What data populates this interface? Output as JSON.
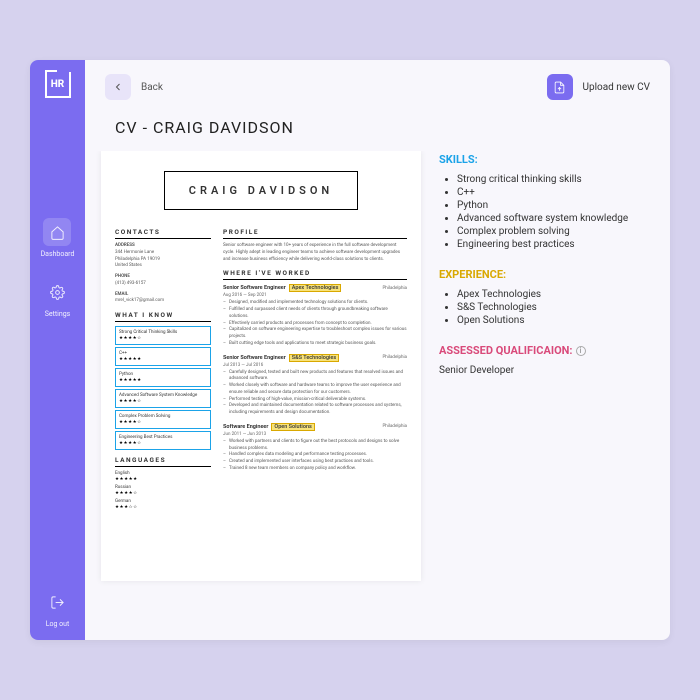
{
  "sidebar": {
    "logo": "HR",
    "items": [
      {
        "label": "Dashboard"
      },
      {
        "label": "Settings"
      }
    ],
    "logout": "Log out"
  },
  "topbar": {
    "back": "Back",
    "upload": "Upload new CV"
  },
  "title": "CV - CRAIG DAVIDSON",
  "resume": {
    "name": "CRAIG DAVIDSON",
    "contacts_h": "CONTACTS",
    "addr_h": "ADDRESS",
    "addr": "344 Hermonie Lane\nPhiladelphia PA 19019\nUnited States",
    "phone_h": "PHONE",
    "phone": "(413) 493-6157",
    "email_h": "EMAIL",
    "email": "mrel_vick17@gmail.com",
    "know_h": "WHAT I KNOW",
    "skills": [
      {
        "name": "Strong Critical Thinking Skills",
        "stars": "★★★★☆"
      },
      {
        "name": "C++",
        "stars": "★★★★★"
      },
      {
        "name": "Python",
        "stars": "★★★★★"
      },
      {
        "name": "Advanced Software System Knowledge",
        "stars": "★★★★☆"
      },
      {
        "name": "Complex Problem Solving",
        "stars": "★★★★☆"
      },
      {
        "name": "Engineering Best Practices",
        "stars": "★★★★☆"
      }
    ],
    "lang_h": "LANGUAGES",
    "langs": [
      {
        "name": "English",
        "stars": "★★★★★"
      },
      {
        "name": "Russian",
        "stars": "★★★★☆"
      },
      {
        "name": "German",
        "stars": "★★★☆☆"
      }
    ],
    "profile_h": "PROFILE",
    "profile": "Senior software engineer with 10+ years of experience in the full software development cycle. Highly adept in leading engineer teams to achieve software development upgrades and increase business efficiency while delivering world-class solutions to clients.",
    "work_h": "WHERE I'VE WORKED",
    "jobs": [
      {
        "title": "Senior Software Engineer",
        "company": "Apex Technologies",
        "loc": "Philadelphia",
        "dates": "Aug 2016 — Sep 2021",
        "bullets": [
          "Designed, modified and implemented technology solutions for clients.",
          "Fulfilled and surpassed client needs of clients through groundbreaking software solutions.",
          "Effectively carried products and processes from concept to completion.",
          "Capitalized on software engineering expertise to troubleshoot complex issues for various projects.",
          "Built cutting edge tools and applications to meet strategic business goals."
        ]
      },
      {
        "title": "Senior Software Engineer",
        "company": "S&S Technologies",
        "loc": "Philadelphia",
        "dates": "Jul 2013 — Jul 2016",
        "bullets": [
          "Carefully designed, tested and built new products and features that resolved issues and advanced software.",
          "Worked closely with software and hardware teams to improve the user experience and ensure reliable and secure data protection for our customers.",
          "Performed testing of high-value, mission-critical deliverable systems.",
          "Developed and maintained documentation related to software processes and systems, including requirements and design documentation."
        ]
      },
      {
        "title": "Software Engineer",
        "company": "Open Solutions",
        "loc": "Philadelphia",
        "dates": "Jun 2011 — Jun 2013",
        "bullets": [
          "Worked with partners and clients to figure out the best protocols and designs to solve business problems.",
          "Handled complex data modeling and performance testing processes.",
          "Created and implemented user interfaces using best practices and tools.",
          "Trained 8 new team members on company policy and workflow."
        ]
      }
    ]
  },
  "panel": {
    "skills_h": "SKILLS:",
    "skills": [
      "Strong critical thinking skills",
      "C++",
      "Python",
      "Advanced software system knowledge",
      "Complex problem solving",
      "Engineering best practices"
    ],
    "exp_h": "EXPERIENCE:",
    "exp": [
      "Apex Technologies",
      "S&S Technologies",
      "Open Solutions"
    ],
    "qual_h": "ASSESSED QUALIFICAION:",
    "qual_v": "Senior Developer"
  }
}
